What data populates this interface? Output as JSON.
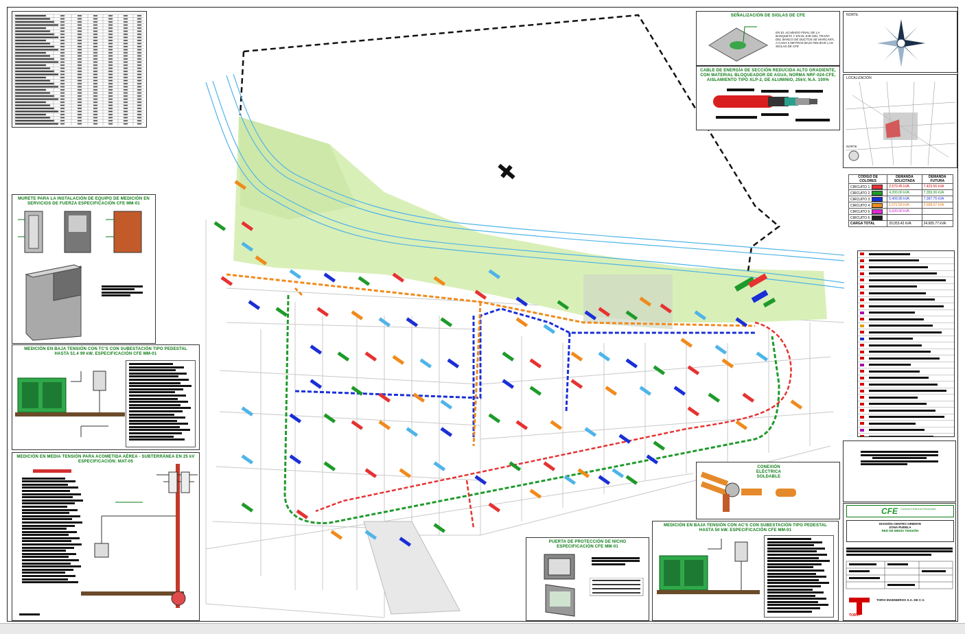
{
  "sheet": {
    "north_label": "NORTE",
    "location_label": "LOCALIZACIÓN",
    "north_small": "NORTE"
  },
  "signage": {
    "title": "SEÑALIZACIÓN DE SIGLAS DE CFE",
    "note": "EN EL ACABADO FINAL DE LA BANQUETA Y EN EL EJE DEL TRAZO DEL BANCO DE DUCTOS SE MARCARÁ, A CADA 5 METROS BAJO RELIEVE LAS SIGLAS DE CFE"
  },
  "cable": {
    "title": "CABLE DE ENERGÍA DE SECCIÓN REDUCIDA ALTO GRADIENTE, CON MATERIAL BLOQUEADOR DE AGUA, NORMA NRF-024-CFE, AISLAMIENTO TIPO XLP-2, DE ALUMINIO, 25kV, N.A. 100%"
  },
  "mufete": {
    "title": "MURETE PARA LA INSTALACIÓN DE EQUIPO DE MEDICIÓN EN SERVICIOS DE FUERZA ESPECIFICACIÓN CFE MM-01"
  },
  "baja_tension": {
    "title": "MEDICIÓN EN BAJA TENSIÓN CON TC'S CON SUBESTACIÓN TIPO PEDESTAL HASTA 51.4 99 kW. ESPECIFICACIÓN CFE MM-01"
  },
  "media_tension": {
    "title": "MEDICIÓN EN MEDIA TENSIÓN PARA ACOMETIDA AÉREA - SUBTERRÁNEA EN 25 kV ESPECIFICACIÓN: MAT-05"
  },
  "conexion": {
    "title": "CONEXIÓN ELÉCTRICA SOLDABLE"
  },
  "puerta": {
    "title": "PUERTA DE PROTECCIÓN DE NICHO ESPECIFICACIÓN CFE MM-01"
  },
  "baja_tension_2": {
    "title": "MEDICIÓN EN BAJA TENSIÓN CON AC'S CON SUBESTACIÓN TIPO PEDESTAL HASTA 50 kW. ESPECIFICACIÓN CFE MM-01"
  },
  "circuits": {
    "headers": [
      "CÓDIGO DE COLORES",
      "DEMANDA SOLICITADA",
      "DEMANDA FUTURA"
    ],
    "rows": [
      {
        "name": "CIRCUITO 1",
        "color": "#e63232",
        "solicitada": "2,570.45 kVA",
        "futura": "7,423.56 kVA",
        "tcolor": "#d40000"
      },
      {
        "name": "CIRCUITO 2",
        "color": "#1e9a2a",
        "solicitada": "4,200.00 kVA",
        "futura": "7,359.36 kVA",
        "tcolor": "#0a8a1a"
      },
      {
        "name": "CIRCUITO 3",
        "color": "#1a2fd6",
        "solicitada": "5,409.95 kVA",
        "futura": "7,367.75 kVA",
        "tcolor": "#1a2fd6"
      },
      {
        "name": "CIRCUITO 4",
        "color": "#f08a1c",
        "solicitada": "1,572.59 kVA",
        "futura": "2,938.07 kVA",
        "tcolor": "#e07000"
      },
      {
        "name": "CIRCUITO 5",
        "color": "#e02ad8",
        "solicitada": "5,630.00 kVA",
        "futura": "-",
        "tcolor": "#d010c8"
      },
      {
        "name": "CIRCUITO 6",
        "color": "#222222",
        "solicitada": "",
        "futura": "",
        "tcolor": "#111"
      }
    ],
    "total_label": "CARGA TOTAL",
    "total_solicitada": "20,053.42 kVA",
    "total_futura": "24,605.77 kVA"
  },
  "titleblock": {
    "cfe_logo": "CFE",
    "cfe_tag": "Comisión Federal de Electricidad",
    "division": "DIVISIÓN CENTRO ORIENTE",
    "zona": "ZONA PUEBLA",
    "red": "RED DE MEDIA TENSIÓN",
    "company": "TORVI INGENIEROS S.A. DE C.V.",
    "company_logo": "TORVI"
  },
  "colors": {
    "c1": "#e63232",
    "c2": "#1e9a2a",
    "c3": "#1a2fd6",
    "c4": "#f08a1c",
    "c5": "#e02ad8",
    "lightblue": "#4fb4e8",
    "greenfield": "#d9efb8",
    "titlegreen": "#0a7a12"
  }
}
